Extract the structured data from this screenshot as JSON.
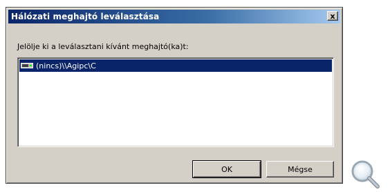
{
  "dialog": {
    "title": "Hálózati meghajtó leválasztása",
    "close_label": "x",
    "instruction": "Jelölje ki a leválasztani kívánt meghajtó(ka)t:",
    "list": {
      "items": [
        {
          "label": "(nincs)\\\\Agipc\\C",
          "icon": "network-drive-icon",
          "selected": true
        }
      ]
    },
    "buttons": {
      "ok_label": "OK",
      "cancel_label": "Mégse"
    }
  },
  "colors": {
    "title_bar_start": "#0a246a",
    "title_bar_end": "#a6caf0",
    "dialog_face": "#d4d0c8",
    "selection": "#0a246a"
  },
  "decoration": {
    "icon": "magnifier-icon"
  }
}
